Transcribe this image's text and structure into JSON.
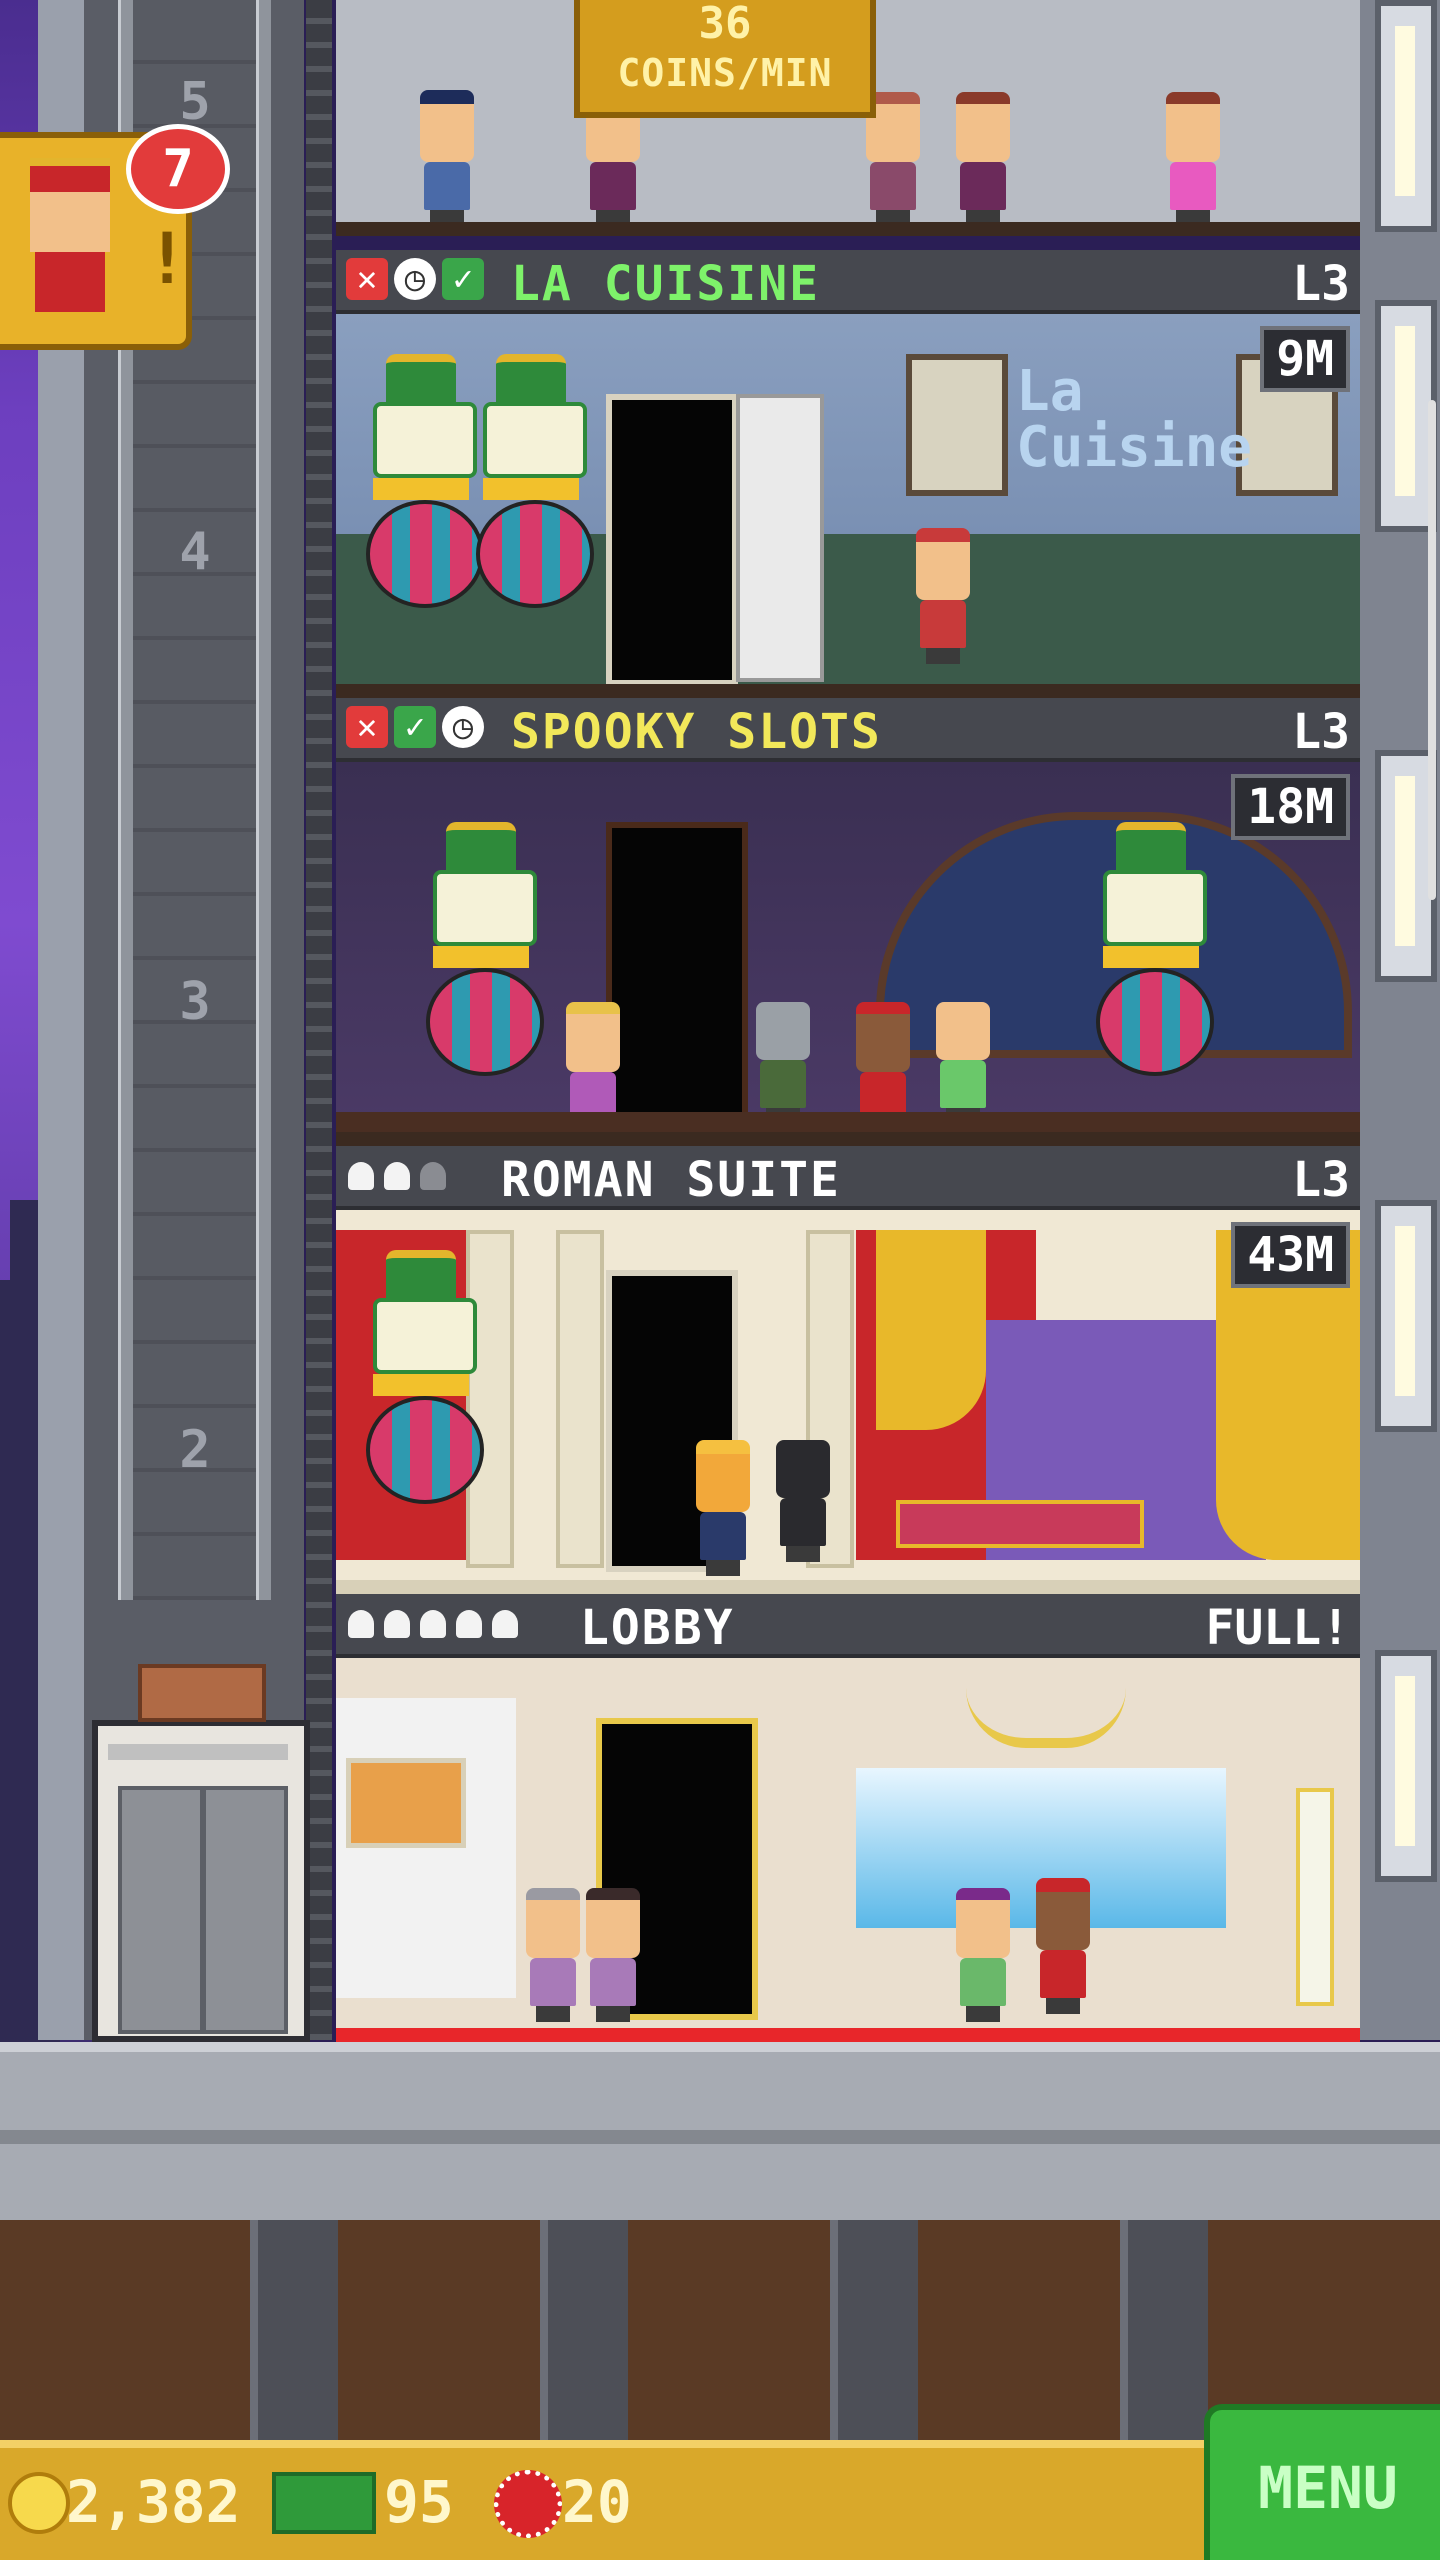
{
  "coins_per_min": {
    "value": "36",
    "label": "COINS/MIN"
  },
  "notification": {
    "count": "7",
    "mark": "!"
  },
  "shaft": {
    "floor_numbers": [
      "5",
      "4",
      "3",
      "2"
    ]
  },
  "floors": [
    {
      "name": "LA CUISINE",
      "level": "L3",
      "timer": "9M",
      "name_color": "#7ef26a",
      "status": [
        "x",
        "clock",
        "check"
      ]
    },
    {
      "name": "SPOOKY SLOTS",
      "level": "L3",
      "timer": "18M",
      "name_color": "#f2e85a",
      "status": [
        "x",
        "check",
        "clock"
      ]
    },
    {
      "name": "ROMAN SUITE",
      "level": "L3",
      "timer": "43M",
      "name_color": "#ffffff",
      "residents": [
        true,
        true,
        false
      ]
    },
    {
      "name": "LOBBY",
      "level": "FULL!",
      "name_color": "#ffffff",
      "residents": [
        true,
        true,
        true,
        true,
        true
      ]
    }
  ],
  "hud": {
    "coins": "2,382",
    "bux": "95",
    "chips": "20",
    "menu_label": "MENU"
  },
  "icons": {
    "coin": "coin-icon",
    "bux": "tower-bux-icon",
    "chip": "vip-chip-icon",
    "notification": "bellhop-icon"
  }
}
